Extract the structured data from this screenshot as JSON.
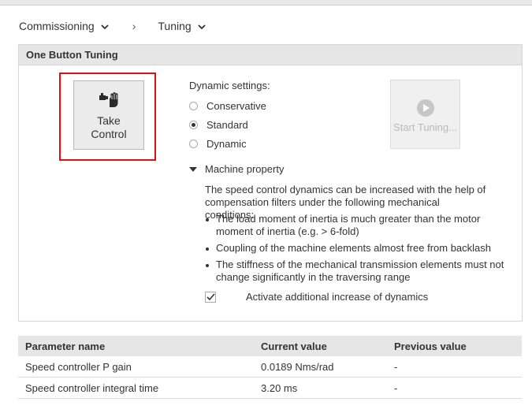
{
  "breadcrumb": {
    "items": [
      {
        "label": "Commissioning"
      },
      {
        "label": "Tuning"
      }
    ],
    "separator": "›"
  },
  "panel": {
    "title": "One Button Tuning",
    "take_control": {
      "line1": "Take",
      "line2": "Control",
      "icon": "hand-control-icon"
    },
    "dynamic": {
      "title": "Dynamic settings:",
      "options": [
        {
          "label": "Conservative",
          "selected": false
        },
        {
          "label": "Standard",
          "selected": true
        },
        {
          "label": "Dynamic",
          "selected": false
        }
      ]
    },
    "start_tuning": {
      "label": "Start Tuning...",
      "enabled": false,
      "icon": "play-icon"
    },
    "machine_property": {
      "label": "Machine property",
      "expanded": true,
      "description": "The speed control dynamics can be increased with the help of compensation filters under the following mechanical conditions:",
      "bullets": [
        "The load moment of inertia is much greater than the motor moment of inertia (e.g. > 6-fold)",
        "Coupling of the machine elements almost free from backlash",
        "The stiffness of the mechanical transmission elements must not change significantly in the traversing range"
      ],
      "checkbox": {
        "label": "Activate additional increase of dynamics",
        "checked": true
      }
    }
  },
  "table": {
    "headers": {
      "name": "Parameter name",
      "current": "Current value",
      "previous": "Previous value"
    },
    "rows": [
      {
        "name": "Speed controller P gain",
        "current": "0.0189 Nms/rad",
        "previous": "-"
      },
      {
        "name": "Speed controller integral time",
        "current": "3.20 ms",
        "previous": "-"
      }
    ]
  },
  "colors": {
    "highlight": "#dd1111",
    "header_bg": "#e6e6e6",
    "text": "#333333",
    "disabled_text": "#b9b9b9"
  }
}
